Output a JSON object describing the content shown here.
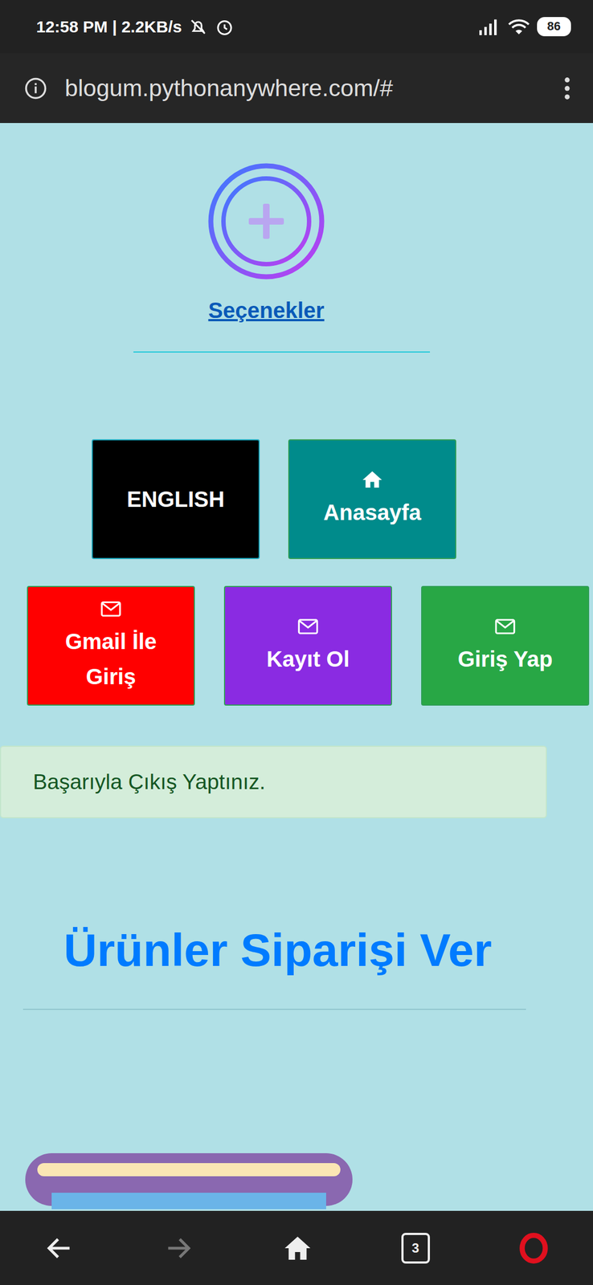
{
  "status_bar": {
    "text": "12:58 PM | 2.2KB/s",
    "battery": "86"
  },
  "address_bar": {
    "url": "blogum.pythonanywhere.com/#"
  },
  "options_link": "Seçenekler",
  "button_rows": [
    [
      {
        "label": "ENGLISH",
        "kind": "plain",
        "color": "#000000"
      },
      {
        "label": "Anasayfa",
        "kind": "home",
        "color": "#008b8b"
      }
    ],
    [
      {
        "label": "Gmail İle Giriş",
        "kind": "mail",
        "color": "#ff0000"
      },
      {
        "label": "Kayıt Ol",
        "kind": "mail",
        "color": "#8a2be2"
      },
      {
        "label": "Giriş Yap",
        "kind": "mail",
        "color": "#28a745"
      }
    ]
  ],
  "alert": "Başarıyla Çıkış Yaptınız.",
  "heading": "Ürünler Siparişi Ver",
  "bottom_nav": {
    "tab_count": "3",
    "forward_disabled": true
  }
}
